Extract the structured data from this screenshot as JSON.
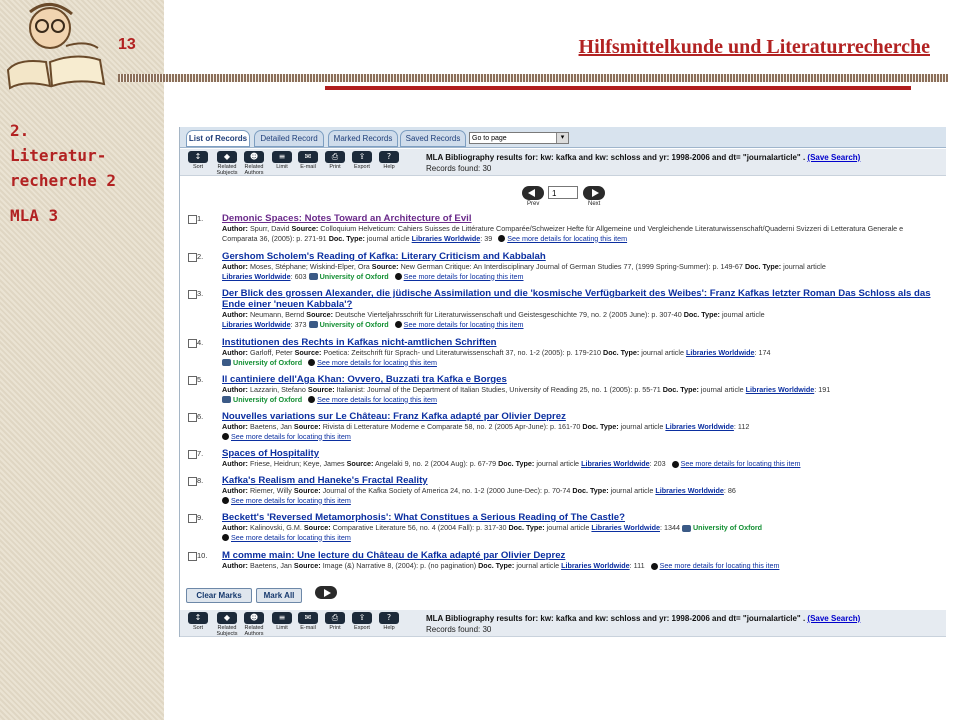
{
  "slide": {
    "number": "13",
    "title": "Hilfsmittelkunde und Literaturrecherche",
    "nav": [
      "2.",
      "Literatur-",
      "recherche 2",
      "MLA 3"
    ]
  },
  "tabs": [
    "List of Records",
    "Detailed Record",
    "Marked Records",
    "Saved Records"
  ],
  "goto": "Go to page",
  "toolbar": {
    "buttons": [
      "Sort",
      "Related\nSubjects",
      "Related\nAuthors",
      "Limit",
      "E-mail",
      "Print",
      "Export",
      "Help"
    ],
    "results_text": "MLA Bibliography results for: kw: kafka and kw: schloss and yr: 1998-2006 and dt= \"journalarticle\" .",
    "save_search": "(Save Search)",
    "records_found": "Records found: 30"
  },
  "pager": {
    "page": "1",
    "prev": "Prev",
    "next": "Next"
  },
  "labels": {
    "author": "Author:",
    "source": "Source:",
    "doctype": "Doc. Type:",
    "libraries": "Libraries Worldwide",
    "oxford": "University of Oxford",
    "see_more": "See more details for locating this item"
  },
  "records": [
    {
      "num": "1.",
      "title": "Demonic Spaces: Notes Toward an Architecture of Evil",
      "author": "Spurr, David",
      "source": "Colloquium Helveticum: Cahiers Suisses de Littérature Comparée/Schweizer Hefte für Allgemeine und Vergleichende Literaturwissenschaft/Quaderni Svizzeri di Letteratura Generale e Comparata 36, (2005): p. 271-91",
      "doctype": "journal article",
      "libs": "39"
    },
    {
      "num": "2.",
      "title": "Gershom Scholem's Reading of Kafka: Literary Criticism and Kabbalah",
      "author": "Moses, Stéphane; Wiskind-Elper, Ora",
      "source": "New German Critique: An Interdisciplinary Journal of German Studies 77, (1999 Spring-Summer): p. 149-67",
      "doctype": "journal article",
      "libs": "603"
    },
    {
      "num": "3.",
      "title": "Der Blick des grossen Alexander, die jüdische Assimilation und die 'kosmische Verfügbarkeit des Weibes': Franz Kafkas letzter Roman Das Schloss als das Ende einer 'neuen Kabbala'?",
      "author": "Neumann, Bernd",
      "source": "Deutsche Vierteljahrsschrift für Literaturwissenschaft und Geistesgeschichte 79, no. 2 (2005 June): p. 307-40",
      "doctype": "journal article",
      "libs": "373"
    },
    {
      "num": "4.",
      "title": "Institutionen des Rechts in Kafkas nicht-amtlichen Schriften",
      "author": "Garloff, Peter",
      "source": "Poetica: Zeitschrift für Sprach- und Literaturwissenschaft 37, no. 1-2 (2005): p. 179-210",
      "doctype": "journal article",
      "libs": "174"
    },
    {
      "num": "5.",
      "title": "Il cantiniere dell'Aga Khan: Ovvero, Buzzati tra Kafka e Borges",
      "author": "Lazzarin, Stefano",
      "source": "Italianist: Journal of the Department of Italian Studies, University of Reading 25, no. 1 (2005): p. 55-71",
      "doctype": "journal article",
      "libs": "191"
    },
    {
      "num": "6.",
      "title": "Nouvelles variations sur Le Château: Franz Kafka adapté par Olivier Deprez",
      "author": "Baetens, Jan",
      "source": "Rivista di Letterature Moderne e Comparate 58, no. 2 (2005 Apr-June): p. 161-70",
      "doctype": "journal article",
      "libs": "112"
    },
    {
      "num": "7.",
      "title": "Spaces of Hospitality",
      "author": "Friese, Heidrun; Keye, James",
      "source": "Angelaki 9, no. 2 (2004 Aug): p. 67-79",
      "doctype": "journal article",
      "libs": "203"
    },
    {
      "num": "8.",
      "title": "Kafka's Realism and Haneke's Fractal Reality",
      "author": "Riemer, Willy",
      "source": "Journal of the Kafka Society of America 24, no. 1-2 (2000 June-Dec): p. 70-74",
      "doctype": "journal article",
      "libs": "86"
    },
    {
      "num": "9.",
      "title": "Beckett's 'Reversed Metamorphosis': What Constitues a Serious Reading of The Castle?",
      "author": "Kalinovski, G.M.",
      "source": "Comparative Literature 56, no. 4 (2004 Fall): p. 317-30",
      "doctype": "journal article",
      "libs": "1344"
    },
    {
      "num": "10.",
      "title": "M comme main: Une lecture du Château de Kafka adapté par Olivier Deprez",
      "author": "Baetens, Jan",
      "source": "Image (&) Narrative 8, (2004): p. (no pagination)",
      "doctype": "journal article",
      "libs": "111"
    }
  ],
  "bottom": {
    "clear": "Clear Marks",
    "mark_all": "Mark All"
  }
}
